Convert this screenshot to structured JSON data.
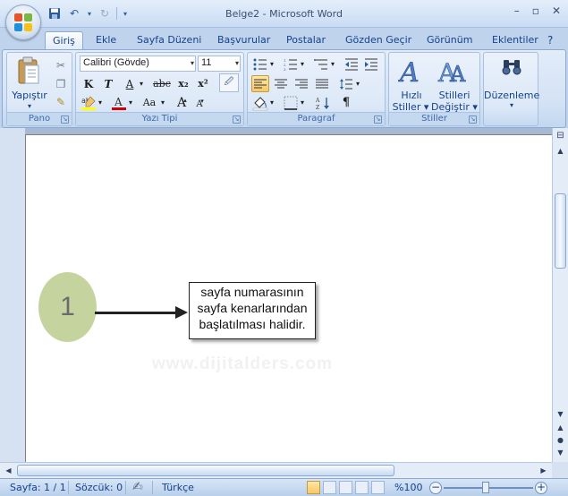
{
  "window": {
    "title": "Belge2 - Microsoft Word",
    "minimize": "–",
    "restore": "▫",
    "close": "✕"
  },
  "quick_access": {
    "save_icon": "save-icon",
    "undo_icon": "undo-icon",
    "redo_icon": "redo-icon"
  },
  "tabs": [
    {
      "label": "Giriş",
      "active": true
    },
    {
      "label": "Ekle"
    },
    {
      "label": "Sayfa Düzeni"
    },
    {
      "label": "Başvurular"
    },
    {
      "label": "Postalar"
    },
    {
      "label": "Gözden Geçir"
    },
    {
      "label": "Görünüm"
    },
    {
      "label": "Eklentiler"
    }
  ],
  "ribbon": {
    "pano": {
      "label": "Pano",
      "paste_label": "Yapıştır"
    },
    "font": {
      "label": "Yazı Tipi",
      "font_name": "Calibri (Gövde)",
      "font_size": "11",
      "bold": "K",
      "italic": "T",
      "underline": "A",
      "strike": "abc",
      "subscript": "x₂",
      "superscript": "x²",
      "change_case": "Aa",
      "grow": "A",
      "shrink": "A"
    },
    "paragraph": {
      "label": "Paragraf",
      "show_marks": "¶"
    },
    "styles": {
      "label": "Stiller",
      "quick_styles_line1": "Hızlı",
      "quick_styles_line2": "Stiller",
      "change_styles_line1": "Stilleri",
      "change_styles_line2": "Değiştir"
    },
    "editing": {
      "label": "Düzenleme"
    }
  },
  "document": {
    "circle_number": "1",
    "callout_lines": [
      "sayfa numarasının",
      "sayfa kenarlarından",
      "başlatılması halidir."
    ],
    "watermark": "www.dijitalders.com"
  },
  "status": {
    "page": "Sayfa: 1 / 1",
    "words": "Sözcük: 0",
    "language": "Türkçe",
    "zoom": "%100",
    "zoom_level_percent": 100
  },
  "colors": {
    "accent": "#15428b",
    "circle_fill": "#c5d49f",
    "ribbon_bg": "#d3e2f5"
  }
}
